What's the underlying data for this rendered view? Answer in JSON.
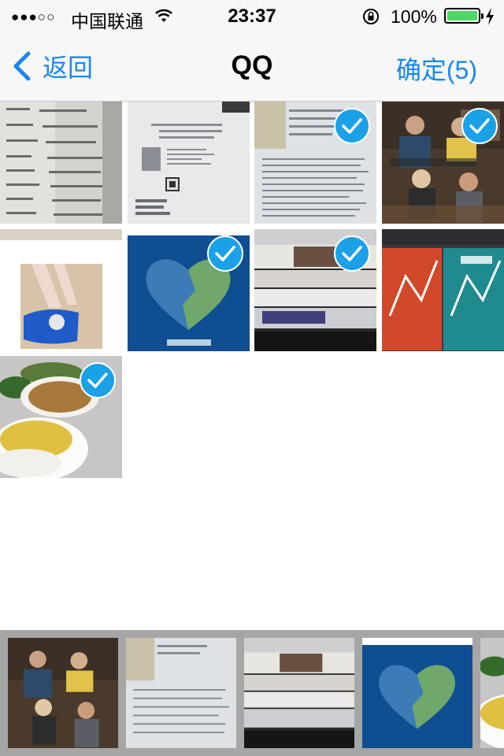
{
  "status_bar": {
    "signal": "●●●○○",
    "carrier": "中国联通",
    "time": "23:37",
    "battery_percent": "100%",
    "battery_color": "#4cd964"
  },
  "nav": {
    "back_label": "返回",
    "title": "QQ",
    "confirm_label": "确定(5)",
    "accent_color": "#1a87f0"
  },
  "grid": {
    "items": [
      {
        "name": "photo-book-page-table",
        "selected": false
      },
      {
        "name": "photo-book-page-linux",
        "selected": false
      },
      {
        "name": "photo-book-page-text",
        "selected": true
      },
      {
        "name": "photo-tv-show-scene",
        "selected": true
      },
      {
        "name": "photo-toy-figure",
        "selected": false
      },
      {
        "name": "photo-heart-logo",
        "selected": true
      },
      {
        "name": "photo-book-stack",
        "selected": true
      },
      {
        "name": "photo-book-covers",
        "selected": false
      },
      {
        "name": "photo-food-bowls",
        "selected": true
      }
    ]
  },
  "strip": {
    "items": [
      {
        "name": "strip-tv-show-scene"
      },
      {
        "name": "strip-book-page-text"
      },
      {
        "name": "strip-book-stack"
      },
      {
        "name": "strip-heart-logo"
      },
      {
        "name": "strip-food-bowls"
      }
    ]
  },
  "icons": [
    "chevron-left-icon",
    "wifi-icon",
    "rotation-lock-icon",
    "battery-icon",
    "charging-bolt-icon",
    "checkmark-icon"
  ]
}
